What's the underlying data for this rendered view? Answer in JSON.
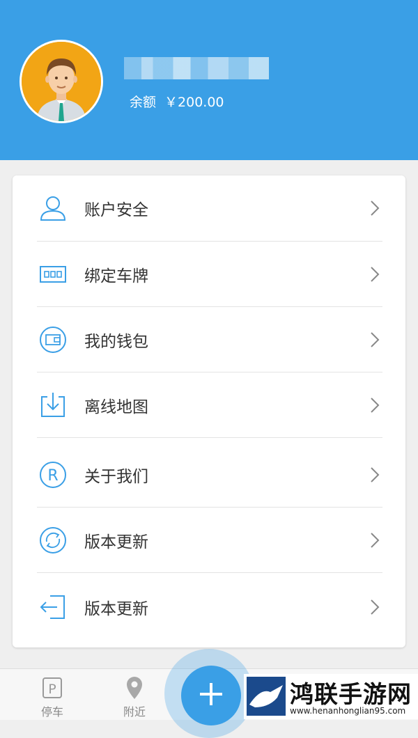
{
  "profile": {
    "avatar_icon": "user-avatar-illustration",
    "username_obscured": true,
    "balance_label": "余额",
    "balance_value": "￥200.00"
  },
  "menu": [
    {
      "icon": "user-icon",
      "label": "账户安全"
    },
    {
      "icon": "license-plate-icon",
      "label": "绑定车牌"
    },
    {
      "icon": "wallet-icon",
      "label": "我的钱包"
    },
    {
      "icon": "download-icon",
      "label": "离线地图"
    },
    {
      "icon": "registered-icon",
      "label": "关于我们"
    },
    {
      "icon": "refresh-icon",
      "label": "版本更新"
    },
    {
      "icon": "logout-icon",
      "label": "版本更新"
    }
  ],
  "tabbar": {
    "parking_label": "停车",
    "nearby_label": "附近"
  },
  "watermark": {
    "title": "鸿联手游网",
    "url": "www.henanhonglian95.com"
  },
  "colors": {
    "primary": "#3a9fe6",
    "icon": "#3a9fe6",
    "text": "#333333"
  }
}
